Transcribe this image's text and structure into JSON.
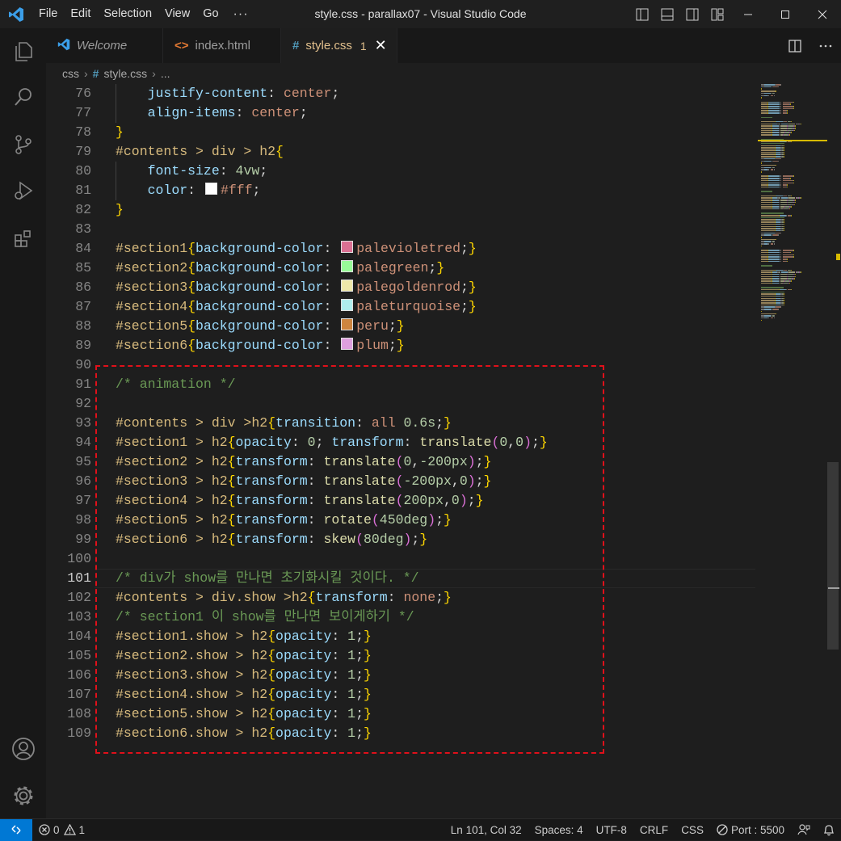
{
  "titlebar": {
    "menu": [
      "File",
      "Edit",
      "Selection",
      "View",
      "Go"
    ],
    "more": "···",
    "title": "style.css - parallax07 - Visual Studio Code"
  },
  "tabs": [
    {
      "label": "Welcome",
      "icon": "vscode-icon"
    },
    {
      "label": "index.html",
      "icon": "html-icon",
      "glyph": "<>"
    },
    {
      "label": "style.css",
      "icon": "css-hash-icon",
      "glyph": "#",
      "badge": "1",
      "close": "✕"
    }
  ],
  "breadcrumb": {
    "folder": "css",
    "file": "style.css",
    "rest": "..."
  },
  "editor": {
    "current_line": 101,
    "lines": [
      {
        "n": 76,
        "tokens": [
          [
            "    ",
            ""
          ],
          [
            "justify-content",
            "prop"
          ],
          [
            ": ",
            ""
          ],
          [
            "center",
            "val"
          ],
          [
            ";",
            ""
          ]
        ]
      },
      {
        "n": 77,
        "tokens": [
          [
            "    ",
            ""
          ],
          [
            "align-items",
            "prop"
          ],
          [
            ": ",
            ""
          ],
          [
            "center",
            "val"
          ],
          [
            ";",
            ""
          ]
        ]
      },
      {
        "n": 78,
        "tokens": [
          [
            "}",
            "b1"
          ]
        ]
      },
      {
        "n": 79,
        "tokens": [
          [
            "#contents > div > h2",
            "sel"
          ],
          [
            "{",
            "b1"
          ]
        ]
      },
      {
        "n": 80,
        "tokens": [
          [
            "    ",
            ""
          ],
          [
            "font-size",
            "prop"
          ],
          [
            ": ",
            ""
          ],
          [
            "4vw",
            "num"
          ],
          [
            ";",
            ""
          ]
        ]
      },
      {
        "n": 81,
        "tokens": [
          [
            "    ",
            ""
          ],
          [
            "color",
            "prop"
          ],
          [
            ": ",
            ""
          ],
          [
            "#ffffff",
            "swatch"
          ],
          [
            "#fff",
            "val"
          ],
          [
            ";",
            ""
          ]
        ]
      },
      {
        "n": 82,
        "tokens": [
          [
            "}",
            "b1"
          ]
        ]
      },
      {
        "n": 83,
        "tokens": []
      },
      {
        "n": 84,
        "tokens": [
          [
            "#section1",
            "sel"
          ],
          [
            "{",
            "b1"
          ],
          [
            "background-color",
            "prop"
          ],
          [
            ": ",
            ""
          ],
          [
            "#db7093",
            "swatch"
          ],
          [
            "palevioletred",
            "val"
          ],
          [
            ";",
            ""
          ],
          [
            "}",
            "b1"
          ]
        ]
      },
      {
        "n": 85,
        "tokens": [
          [
            "#section2",
            "sel"
          ],
          [
            "{",
            "b1"
          ],
          [
            "background-color",
            "prop"
          ],
          [
            ": ",
            ""
          ],
          [
            "#98fb98",
            "swatch"
          ],
          [
            "palegreen",
            "val"
          ],
          [
            ";",
            ""
          ],
          [
            "}",
            "b1"
          ]
        ]
      },
      {
        "n": 86,
        "tokens": [
          [
            "#section3",
            "sel"
          ],
          [
            "{",
            "b1"
          ],
          [
            "background-color",
            "prop"
          ],
          [
            ": ",
            ""
          ],
          [
            "#eee8aa",
            "swatch"
          ],
          [
            "palegoldenrod",
            "val"
          ],
          [
            ";",
            ""
          ],
          [
            "}",
            "b1"
          ]
        ]
      },
      {
        "n": 87,
        "tokens": [
          [
            "#section4",
            "sel"
          ],
          [
            "{",
            "b1"
          ],
          [
            "background-color",
            "prop"
          ],
          [
            ": ",
            ""
          ],
          [
            "#afeeee",
            "swatch"
          ],
          [
            "paleturquoise",
            "val"
          ],
          [
            ";",
            ""
          ],
          [
            "}",
            "b1"
          ]
        ]
      },
      {
        "n": 88,
        "tokens": [
          [
            "#section5",
            "sel"
          ],
          [
            "{",
            "b1"
          ],
          [
            "background-color",
            "prop"
          ],
          [
            ": ",
            ""
          ],
          [
            "#cd853f",
            "swatch"
          ],
          [
            "peru",
            "val"
          ],
          [
            ";",
            ""
          ],
          [
            "}",
            "b1"
          ]
        ]
      },
      {
        "n": 89,
        "tokens": [
          [
            "#section6",
            "sel"
          ],
          [
            "{",
            "b1"
          ],
          [
            "background-color",
            "prop"
          ],
          [
            ": ",
            ""
          ],
          [
            "#dda0dd",
            "swatch"
          ],
          [
            "plum",
            "val"
          ],
          [
            ";",
            ""
          ],
          [
            "}",
            "b1"
          ]
        ]
      },
      {
        "n": 90,
        "tokens": []
      },
      {
        "n": 91,
        "tokens": [
          [
            "/* animation */",
            "cm"
          ]
        ]
      },
      {
        "n": 92,
        "tokens": []
      },
      {
        "n": 93,
        "tokens": [
          [
            "#contents > div >h2",
            "sel"
          ],
          [
            "{",
            "b1"
          ],
          [
            "transition",
            "prop"
          ],
          [
            ": ",
            ""
          ],
          [
            "all ",
            "val"
          ],
          [
            "0.6s",
            "num"
          ],
          [
            ";",
            ""
          ],
          [
            "}",
            "b1"
          ]
        ]
      },
      {
        "n": 94,
        "tokens": [
          [
            "#section1 > h2",
            "sel"
          ],
          [
            "{",
            "b1"
          ],
          [
            "opacity",
            "prop"
          ],
          [
            ": ",
            ""
          ],
          [
            "0",
            "num"
          ],
          [
            "; ",
            ""
          ],
          [
            "transform",
            "prop"
          ],
          [
            ": ",
            ""
          ],
          [
            "translate",
            "fn"
          ],
          [
            "(",
            "b2"
          ],
          [
            "0",
            "num"
          ],
          [
            ",",
            ""
          ],
          [
            "0",
            "num"
          ],
          [
            ")",
            "b2"
          ],
          [
            ";",
            ""
          ],
          [
            "}",
            "b1"
          ]
        ]
      },
      {
        "n": 95,
        "tokens": [
          [
            "#section2 > h2",
            "sel"
          ],
          [
            "{",
            "b1"
          ],
          [
            "transform",
            "prop"
          ],
          [
            ": ",
            ""
          ],
          [
            "translate",
            "fn"
          ],
          [
            "(",
            "b2"
          ],
          [
            "0",
            "num"
          ],
          [
            ",",
            ""
          ],
          [
            "-200px",
            "num"
          ],
          [
            ")",
            "b2"
          ],
          [
            ";",
            ""
          ],
          [
            "}",
            "b1"
          ]
        ]
      },
      {
        "n": 96,
        "tokens": [
          [
            "#section3 > h2",
            "sel"
          ],
          [
            "{",
            "b1"
          ],
          [
            "transform",
            "prop"
          ],
          [
            ": ",
            ""
          ],
          [
            "translate",
            "fn"
          ],
          [
            "(",
            "b2"
          ],
          [
            "-200px",
            "num"
          ],
          [
            ",",
            ""
          ],
          [
            "0",
            "num"
          ],
          [
            ")",
            "b2"
          ],
          [
            ";",
            ""
          ],
          [
            "}",
            "b1"
          ]
        ]
      },
      {
        "n": 97,
        "tokens": [
          [
            "#section4 > h2",
            "sel"
          ],
          [
            "{",
            "b1"
          ],
          [
            "transform",
            "prop"
          ],
          [
            ": ",
            ""
          ],
          [
            "translate",
            "fn"
          ],
          [
            "(",
            "b2"
          ],
          [
            "200px",
            "num"
          ],
          [
            ",",
            ""
          ],
          [
            "0",
            "num"
          ],
          [
            ")",
            "b2"
          ],
          [
            ";",
            ""
          ],
          [
            "}",
            "b1"
          ]
        ]
      },
      {
        "n": 98,
        "tokens": [
          [
            "#section5 > h2",
            "sel"
          ],
          [
            "{",
            "b1"
          ],
          [
            "transform",
            "prop"
          ],
          [
            ": ",
            ""
          ],
          [
            "rotate",
            "fn"
          ],
          [
            "(",
            "b2"
          ],
          [
            "450deg",
            "num"
          ],
          [
            ")",
            "b2"
          ],
          [
            ";",
            ""
          ],
          [
            "}",
            "b1"
          ]
        ]
      },
      {
        "n": 99,
        "tokens": [
          [
            "#section6 > h2",
            "sel"
          ],
          [
            "{",
            "b1"
          ],
          [
            "transform",
            "prop"
          ],
          [
            ": ",
            ""
          ],
          [
            "skew",
            "fn"
          ],
          [
            "(",
            "b2"
          ],
          [
            "80deg",
            "num"
          ],
          [
            ")",
            "b2"
          ],
          [
            ";",
            ""
          ],
          [
            "}",
            "b1"
          ]
        ]
      },
      {
        "n": 100,
        "tokens": []
      },
      {
        "n": 101,
        "tokens": [
          [
            "/* div가 show를 만나면 초기화시킬 것이다. */",
            "cm"
          ]
        ]
      },
      {
        "n": 102,
        "tokens": [
          [
            "#contents > div.show >h2",
            "sel"
          ],
          [
            "{",
            "b1"
          ],
          [
            "transform",
            "prop"
          ],
          [
            ": ",
            ""
          ],
          [
            "none",
            "val"
          ],
          [
            ";",
            ""
          ],
          [
            "}",
            "b1"
          ]
        ]
      },
      {
        "n": 103,
        "tokens": [
          [
            "/* section1 이 show를 만나면 보이게하기 */",
            "cm"
          ]
        ]
      },
      {
        "n": 104,
        "tokens": [
          [
            "#section1.show > h2",
            "sel"
          ],
          [
            "{",
            "b1"
          ],
          [
            "opacity",
            "prop"
          ],
          [
            ": ",
            ""
          ],
          [
            "1",
            "num"
          ],
          [
            ";",
            ""
          ],
          [
            "}",
            "b1"
          ]
        ]
      },
      {
        "n": 105,
        "tokens": [
          [
            "#section2.show > h2",
            "sel"
          ],
          [
            "{",
            "b1"
          ],
          [
            "opacity",
            "prop"
          ],
          [
            ": ",
            ""
          ],
          [
            "1",
            "num"
          ],
          [
            ";",
            ""
          ],
          [
            "}",
            "b1"
          ]
        ]
      },
      {
        "n": 106,
        "tokens": [
          [
            "#section3.show > h2",
            "sel"
          ],
          [
            "{",
            "b1"
          ],
          [
            "opacity",
            "prop"
          ],
          [
            ": ",
            ""
          ],
          [
            "1",
            "num"
          ],
          [
            ";",
            ""
          ],
          [
            "}",
            "b1"
          ]
        ]
      },
      {
        "n": 107,
        "tokens": [
          [
            "#section4.show > h2",
            "sel"
          ],
          [
            "{",
            "b1"
          ],
          [
            "opacity",
            "prop"
          ],
          [
            ": ",
            ""
          ],
          [
            "1",
            "num"
          ],
          [
            ";",
            ""
          ],
          [
            "}",
            "b1"
          ]
        ]
      },
      {
        "n": 108,
        "tokens": [
          [
            "#section5.show > h2",
            "sel"
          ],
          [
            "{",
            "b1"
          ],
          [
            "opacity",
            "prop"
          ],
          [
            ": ",
            ""
          ],
          [
            "1",
            "num"
          ],
          [
            ";",
            ""
          ],
          [
            "}",
            "b1"
          ]
        ]
      },
      {
        "n": 109,
        "tokens": [
          [
            "#section6.show > h2",
            "sel"
          ],
          [
            "{",
            "b1"
          ],
          [
            "opacity",
            "prop"
          ],
          [
            ": ",
            ""
          ],
          [
            "1",
            "num"
          ],
          [
            ";",
            ""
          ],
          [
            "}",
            "b1"
          ]
        ]
      }
    ]
  },
  "statusbar": {
    "errors": "0",
    "warnings": "1",
    "position": "Ln 101, Col 32",
    "spaces": "Spaces: 4",
    "encoding": "UTF-8",
    "eol": "CRLF",
    "language": "CSS",
    "port": "Port : 5500"
  },
  "colors": {
    "accent": "#0078d4",
    "annotation_box": "#e0101a",
    "modified_tab": "#e2c08d"
  }
}
